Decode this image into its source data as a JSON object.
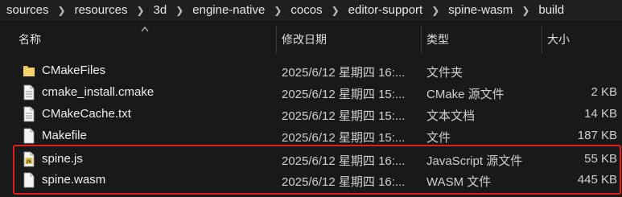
{
  "breadcrumb": [
    "sources",
    "resources",
    "3d",
    "engine-native",
    "cocos",
    "editor-support",
    "spine-wasm",
    "build"
  ],
  "columns": {
    "name": "名称",
    "date": "修改日期",
    "type": "类型",
    "size": "大小"
  },
  "files": [
    {
      "name": "CMakeFiles",
      "date": "2025/6/12 星期四 16:...",
      "type": "文件夹",
      "size": "",
      "icon": "folder-icon"
    },
    {
      "name": "cmake_install.cmake",
      "date": "2025/6/12 星期四 15:...",
      "type": "CMake 源文件",
      "size": "2 KB",
      "icon": "text-file-icon"
    },
    {
      "name": "CMakeCache.txt",
      "date": "2025/6/12 星期四 15:...",
      "type": "文本文档",
      "size": "14 KB",
      "icon": "text-file-icon"
    },
    {
      "name": "Makefile",
      "date": "2025/6/12 星期四 15:...",
      "type": "文件",
      "size": "187 KB",
      "icon": "file-icon"
    },
    {
      "name": "spine.js",
      "date": "2025/6/12 星期四 16:...",
      "type": "JavaScript 源文件",
      "size": "55 KB",
      "icon": "js-file-icon"
    },
    {
      "name": "spine.wasm",
      "date": "2025/6/12 星期四 16:...",
      "type": "WASM 文件",
      "size": "445 KB",
      "icon": "file-icon"
    }
  ],
  "colors": {
    "highlight": "#e0201c",
    "folder": "#f2c14e",
    "js_badge": "#e6c84a"
  }
}
